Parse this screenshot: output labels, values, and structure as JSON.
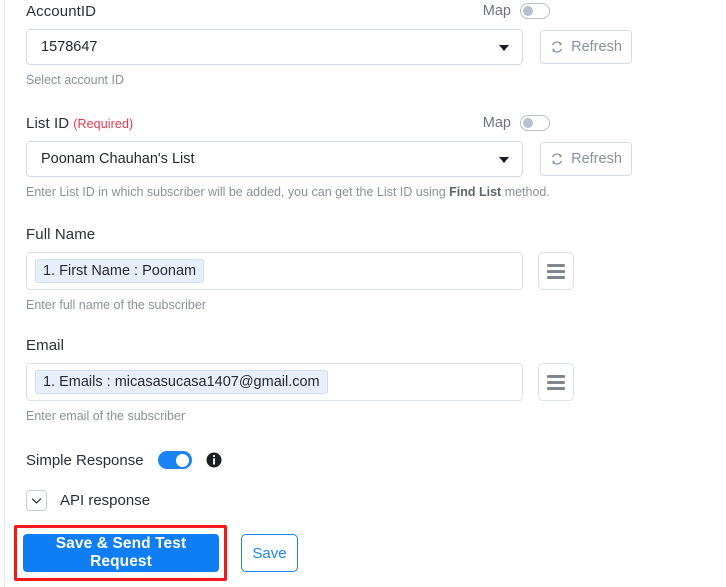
{
  "accent_colors": {
    "primary_blue": "#0f7ef5",
    "required_red": "#e8384f",
    "highlight_red": "#f51818",
    "chip_blue": "#e7effa"
  },
  "fields": {
    "account_id": {
      "label": "AccountID",
      "map_label": "Map",
      "map_toggle_state": "off",
      "value": "1578647",
      "refresh_label": "Refresh",
      "helper": "Select account ID"
    },
    "list_id": {
      "label": "List ID",
      "required_text": "(Required)",
      "map_label": "Map",
      "map_toggle_state": "off",
      "value": "Poonam Chauhan's List",
      "refresh_label": "Refresh",
      "helper_before": "Enter List ID in which subscriber will be added, you can get the List ID using ",
      "helper_link": "Find List",
      "helper_after": " method."
    },
    "full_name": {
      "label": "Full Name",
      "token": "1. First Name : Poonam",
      "helper": "Enter full name of the subscriber"
    },
    "email": {
      "label": "Email",
      "token": "1. Emails : micasasucasa1407@gmail.com",
      "helper": "Enter email of the subscriber"
    }
  },
  "simple_response": {
    "label": "Simple Response",
    "toggle_state": "on"
  },
  "api_response": {
    "label": "API response",
    "expanded": false
  },
  "actions": {
    "primary_label": "Save & Send Test Request",
    "secondary_label": "Save"
  }
}
